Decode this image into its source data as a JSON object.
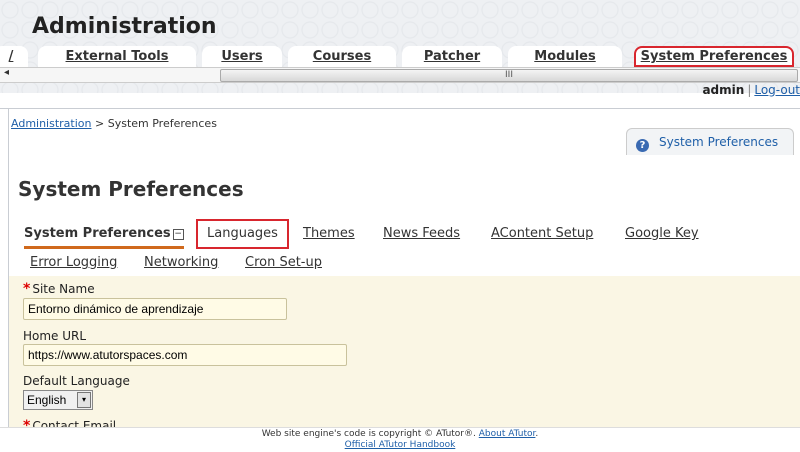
{
  "app": {
    "title": "Administration"
  },
  "nav_tabs": [
    {
      "label": "/"
    },
    {
      "label": "External Tools"
    },
    {
      "label": "Users"
    },
    {
      "label": "Courses"
    },
    {
      "label": "Patcher"
    },
    {
      "label": "Modules"
    },
    {
      "label": "System Preferences"
    }
  ],
  "scrollbar": {
    "left_arrow": "◂",
    "grip": "III"
  },
  "user": {
    "name": "admin",
    "separator": "|",
    "logout": "Log-out"
  },
  "breadcrumb": {
    "root": "Administration",
    "separator": ">",
    "current": "System Preferences"
  },
  "help_tab": {
    "icon": "?",
    "label": "System Preferences"
  },
  "page": {
    "title": "System Preferences"
  },
  "sub_tabs": {
    "current": "System Preferences",
    "collapse": "−",
    "items": [
      "Languages",
      "Themes",
      "News Feeds",
      "AContent Setup",
      "Google Key"
    ],
    "row2": [
      "Error Logging",
      "Networking",
      "Cron Set-up"
    ]
  },
  "form": {
    "required_mark": "*",
    "site_name": {
      "label": "Site Name",
      "value": "Entorno dinámico de aprendizaje"
    },
    "home_url": {
      "label": "Home URL",
      "value": "https://www.atutorspaces.com"
    },
    "default_language": {
      "label": "Default Language",
      "value": "English",
      "arrow": "▾"
    },
    "contact_email": {
      "label": "Contact Email"
    }
  },
  "footer": {
    "copyright": "Web site engine's code is copyright © ATutor®.",
    "about_link": "About ATutor",
    "handbook_link": "Official ATutor Handbook"
  },
  "colors": {
    "highlight": "#d8262e",
    "link": "#1f5fa8",
    "form_bg": "#faf6e4",
    "current_tab_underline": "#d0691c"
  }
}
